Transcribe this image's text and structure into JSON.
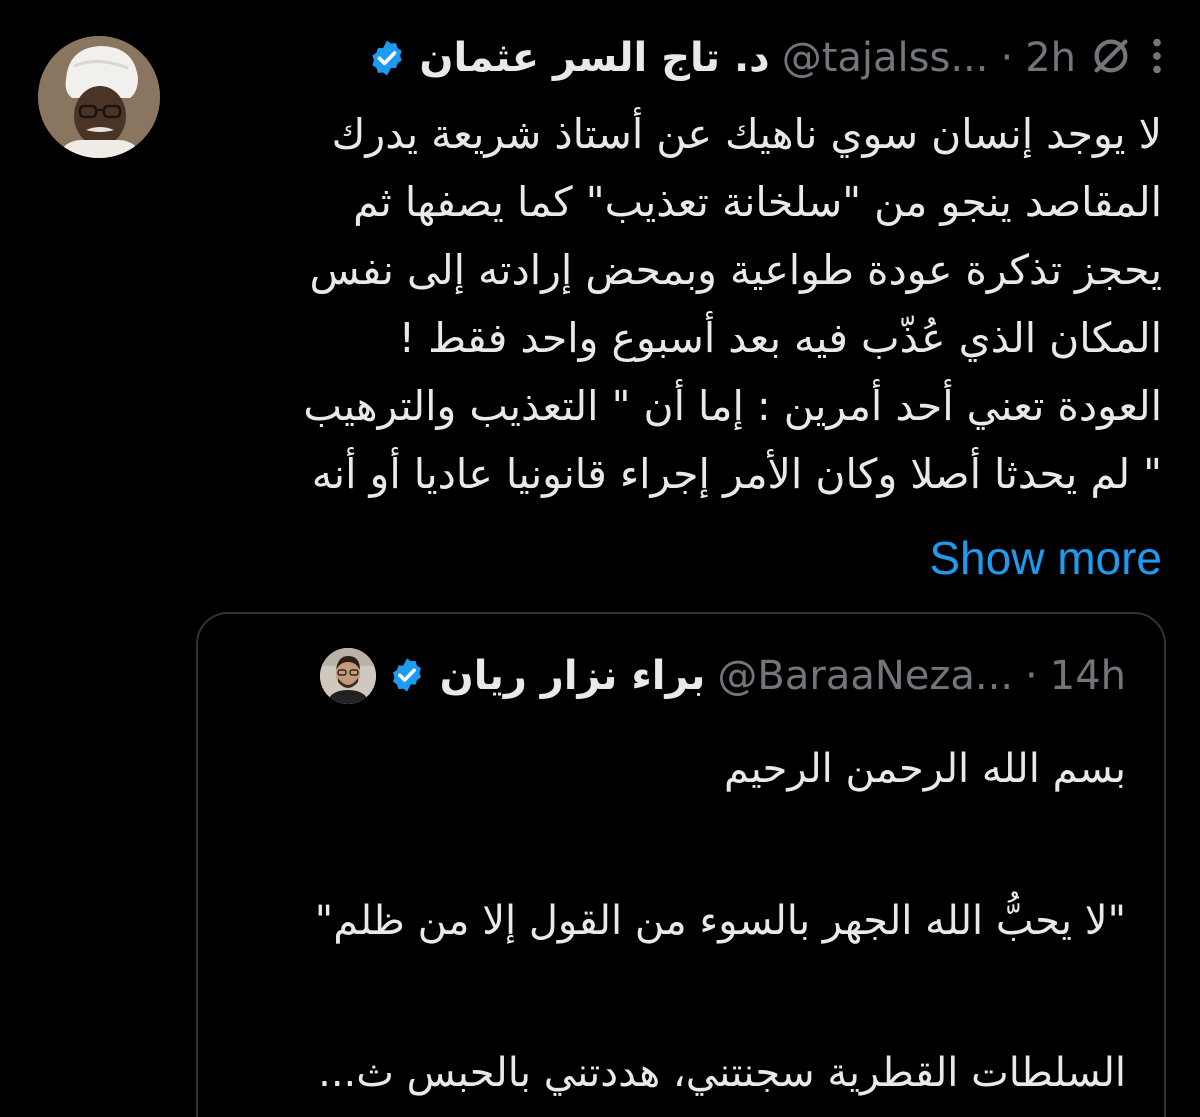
{
  "tweet": {
    "author_name": "د. تاج السر عثمان",
    "handle": "@tajalss...",
    "separator": "·",
    "time": "2h",
    "body_lines": [
      "لا يوجد إنسان سوي ناهيك عن أستاذ شريعة يدرك",
      "المقاصد ينجو من \"سلخانة تعذيب\" كما يصفها ثم",
      "يحجز تذكرة عودة طواعية وبمحض إرادته إلى نفس",
      "المكان الذي عُذّب فيه بعد أسبوع واحد فقط !",
      "العودة تعني أحد أمرين : إما أن \" التعذيب والترهيب",
      "\" لم يحدثا أصلا وكان الأمر إجراء قانونيا عاديا أو أنه"
    ],
    "show_more": "Show more",
    "icons": {
      "verified": "verified-badge-icon",
      "grok": "slash-circle-icon",
      "more": "more-vertical-icon"
    }
  },
  "quote": {
    "author_name": "براء نزار ريان",
    "handle": "@BaraaNeza...",
    "separator": "·",
    "time": "14h",
    "body_lines": [
      "بسم الله الرحمن الرحيم",
      "\"لا يحبُّ الله الجهر بالسوء من القول إلا من ظلم\"",
      "السلطات القطرية سجنتني، هددتني بالحبس ث..."
    ]
  },
  "colors": {
    "background": "#000000",
    "text": "#e7e9ea",
    "muted": "#71767b",
    "accent": "#1d9bf0",
    "border": "#2f3336"
  }
}
